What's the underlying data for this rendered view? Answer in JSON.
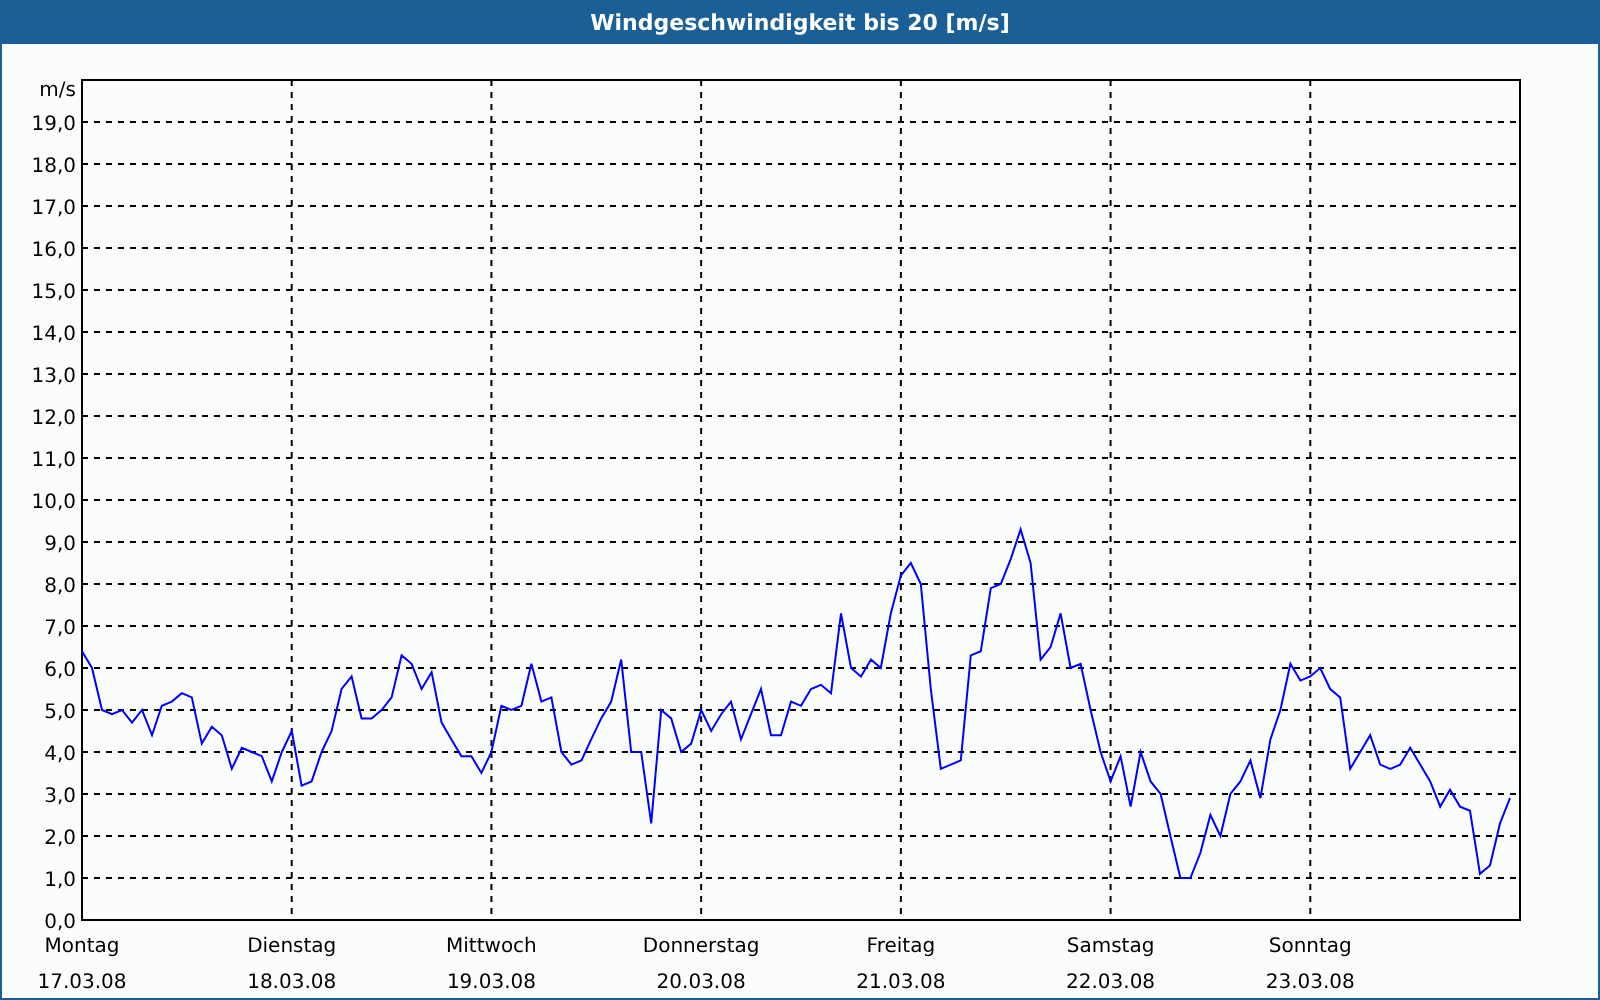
{
  "window": {
    "title": "Windgeschwindigkeit bis 20 [m/s]"
  },
  "chart": {
    "chart_data": {
      "type": "line",
      "grid": true,
      "ylabel": "m/s",
      "ylim": [
        0,
        20
      ],
      "categories": [
        "17.03.08",
        null,
        null,
        null,
        null,
        null,
        null,
        null,
        null,
        null,
        null,
        null,
        null,
        null,
        null,
        null,
        null,
        null,
        null,
        null,
        null,
        "18.03.08",
        null,
        null,
        null,
        null,
        null,
        null,
        null,
        null,
        null,
        null,
        null,
        null,
        null,
        null,
        null,
        null,
        null,
        null,
        null,
        "19.03.08",
        null,
        null,
        null,
        null,
        null,
        null,
        null,
        null,
        null,
        null,
        null,
        null,
        null,
        null,
        null,
        null,
        null,
        null,
        null,
        null,
        "20.03.08",
        null,
        null,
        null,
        null,
        null,
        null,
        null,
        null,
        null,
        null,
        null,
        null,
        null,
        null,
        null,
        null,
        null,
        null,
        null,
        "21.03.08",
        null,
        null,
        null,
        null,
        null,
        null,
        null,
        null,
        null,
        null,
        null,
        null,
        null,
        null,
        null,
        null,
        null,
        null,
        null,
        null,
        "22.03.08",
        null,
        null,
        null,
        null,
        null,
        null,
        null,
        null,
        null,
        null,
        null,
        null,
        null,
        null,
        null,
        null,
        null,
        null,
        null,
        "23.03.08",
        null,
        null,
        null,
        null,
        null,
        null,
        null,
        null,
        null,
        null,
        null,
        null,
        null,
        null,
        null,
        null,
        null,
        null,
        null,
        null
      ],
      "yticks": [
        {
          "value": 0,
          "label": "0,0"
        },
        {
          "value": 1,
          "label": "1,0"
        },
        {
          "value": 2,
          "label": "2,0"
        },
        {
          "value": 3,
          "label": "3,0"
        },
        {
          "value": 4,
          "label": "4,0"
        },
        {
          "value": 5,
          "label": "5,0"
        },
        {
          "value": 6,
          "label": "6,0"
        },
        {
          "value": 7,
          "label": "7,0"
        },
        {
          "value": 8,
          "label": "8,0"
        },
        {
          "value": 9,
          "label": "9,0"
        },
        {
          "value": 10,
          "label": "10,0"
        },
        {
          "value": 11,
          "label": "11,0"
        },
        {
          "value": 12,
          "label": "12,0"
        },
        {
          "value": 13,
          "label": "13,0"
        },
        {
          "value": 14,
          "label": "14,0"
        },
        {
          "value": 15,
          "label": "15,0"
        },
        {
          "value": 16,
          "label": "16,0"
        },
        {
          "value": 17,
          "label": "17,0"
        },
        {
          "value": 18,
          "label": "18,0"
        },
        {
          "value": 19,
          "label": "19,0"
        }
      ],
      "series": [
        {
          "color": "#0000ff",
          "values": [
            6.4,
            6.0,
            5.0,
            4.9,
            5.0,
            4.7,
            5.0,
            4.4,
            5.1,
            5.2,
            5.4,
            5.3,
            4.2,
            4.6,
            4.4,
            3.6,
            4.1,
            4.0,
            3.9,
            3.3,
            4.0,
            4.5,
            3.2,
            3.3,
            4.0,
            4.5,
            5.5,
            5.8,
            4.8,
            4.8,
            5.0,
            5.3,
            6.3,
            6.1,
            5.5,
            5.9,
            4.7,
            4.3,
            3.9,
            3.9,
            3.5,
            4.0,
            5.1,
            5.0,
            5.1,
            6.1,
            5.2,
            5.3,
            4.0,
            3.7,
            3.8,
            4.3,
            4.8,
            5.2,
            6.2,
            4.0,
            4.0,
            2.3,
            5.0,
            4.8,
            4.0,
            4.2,
            5.0,
            4.5,
            4.9,
            5.2,
            4.3,
            4.9,
            5.5,
            4.4,
            4.4,
            5.2,
            5.1,
            5.5,
            5.6,
            5.4,
            7.3,
            6.0,
            5.8,
            6.2,
            6.0,
            7.3,
            8.2,
            8.5,
            8.0,
            5.5,
            3.6,
            3.7,
            3.8,
            6.3,
            6.4,
            7.9,
            8.0,
            8.6,
            9.3,
            8.5,
            6.2,
            6.5,
            7.3,
            6.0,
            6.1,
            5.0,
            4.0,
            3.3,
            3.9,
            2.7,
            4.0,
            3.3,
            3.0,
            2.0,
            1.0,
            1.0,
            1.6,
            2.5,
            2.0,
            3.0,
            3.3,
            3.8,
            2.9,
            4.3,
            5.0,
            6.1,
            5.7,
            5.8,
            6.0,
            5.5,
            5.3,
            3.6,
            4.0,
            4.4,
            3.7,
            3.6,
            3.7,
            4.1,
            3.7,
            3.3,
            2.7,
            3.1,
            2.7,
            2.6,
            1.1,
            1.3,
            2.3,
            2.9
          ]
        }
      ]
    },
    "x_axis_days": [
      "Montag",
      "Dienstag",
      "Mittwoch",
      "Donnerstag",
      "Freitag",
      "Samstag",
      "Sonntag"
    ]
  }
}
